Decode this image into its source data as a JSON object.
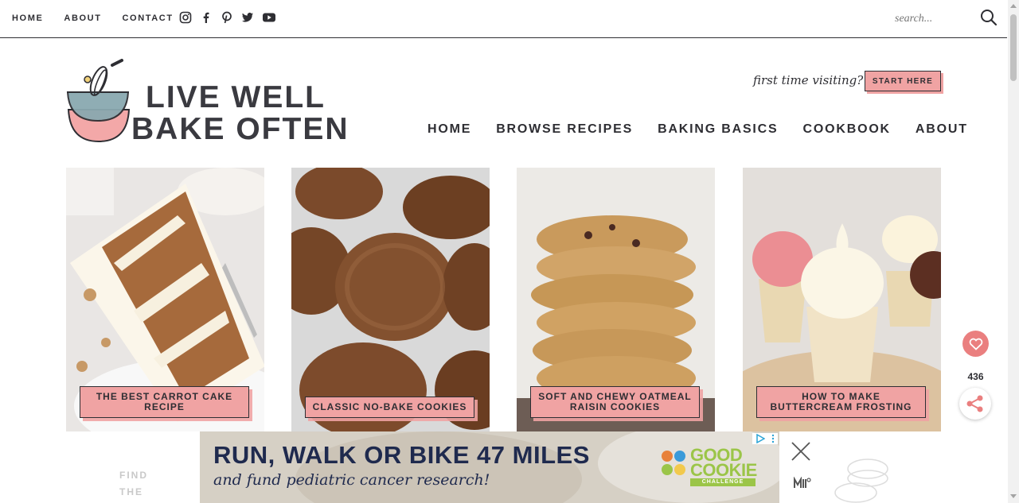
{
  "topnav": [
    "HOME",
    "ABOUT",
    "CONTACT"
  ],
  "social": [
    "instagram-icon",
    "facebook-icon",
    "pinterest-icon",
    "twitter-icon",
    "youtube-icon"
  ],
  "search": {
    "placeholder": "search..."
  },
  "logo": {
    "line1": "LIVE WELL",
    "line2": "BAKE OFTEN"
  },
  "promo": {
    "text": "first time visiting?",
    "button": "START HERE"
  },
  "mainnav": [
    "HOME",
    "BROWSE RECIPES",
    "BAKING BASICS",
    "COOKBOOK",
    "ABOUT"
  ],
  "cards": [
    {
      "label": "THE BEST CARROT CAKE RECIPE"
    },
    {
      "label": "CLASSIC NO-BAKE COOKIES"
    },
    {
      "label": "SOFT AND CHEWY OATMEAL RAISIN COOKIES"
    },
    {
      "label": "HOW TO MAKE BUTTERCREAM FROSTING"
    }
  ],
  "share": {
    "count": "436"
  },
  "partial": {
    "line1": "FIND",
    "line2": "THE"
  },
  "ad": {
    "headline": "RUN, WALK OR BIKE 47 MILES",
    "subline": "and fund pediatric cancer research!",
    "brand1": "GOOD",
    "brand2": "COOKIE",
    "brand3": "CHALLENGE"
  },
  "colors": {
    "accent": "#f0a3a3",
    "dark": "#2e2e33",
    "heart": "#ea7f7f"
  }
}
